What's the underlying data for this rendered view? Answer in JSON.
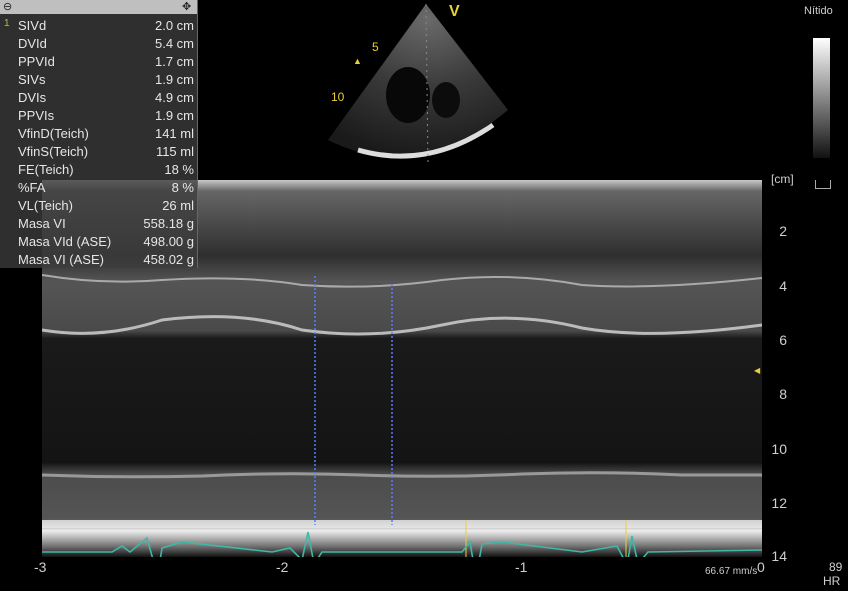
{
  "top_right_label": "Nítido",
  "probe_marker": "V",
  "sector_depths": [
    "5",
    "10"
  ],
  "measurements": {
    "index": "1",
    "rows": [
      {
        "label": "SIVd",
        "value": "2.0 cm"
      },
      {
        "label": "DVId",
        "value": "5.4 cm"
      },
      {
        "label": "PPVId",
        "value": "1.7 cm"
      },
      {
        "label": "SIVs",
        "value": "1.9 cm"
      },
      {
        "label": "DVIs",
        "value": "4.9 cm"
      },
      {
        "label": "PPVIs",
        "value": "1.9 cm"
      },
      {
        "label": "VfinD(Teich)",
        "value": "141 ml"
      },
      {
        "label": "VfinS(Teich)",
        "value": "115 ml"
      },
      {
        "label": "FE(Teich)",
        "value": "18 %"
      },
      {
        "label": "%FA",
        "value": "8 %"
      },
      {
        "label": "VL(Teich)",
        "value": "26 ml"
      },
      {
        "label": "Masa VI",
        "value": "558.18 g"
      },
      {
        "label": "Masa VId (ASE)",
        "value": "498.00 g"
      },
      {
        "label": "Masa VI (ASE)",
        "value": "458.02 g"
      }
    ]
  },
  "depth_axis": {
    "unit": "[cm]",
    "ticks": [
      "2",
      "4",
      "6",
      "8",
      "10",
      "12",
      "14"
    ]
  },
  "time_axis": {
    "ticks": [
      "-3",
      "-2",
      "-1",
      "0"
    ]
  },
  "sweep_speed": "66.67 mm/s",
  "heart_rate": {
    "value": "89",
    "label": "HR"
  },
  "colors": {
    "ecg": "#3fb8a8",
    "caliper": "#5a7cff",
    "marker": "#e8d038",
    "panel_header": "#bfbfbf"
  }
}
